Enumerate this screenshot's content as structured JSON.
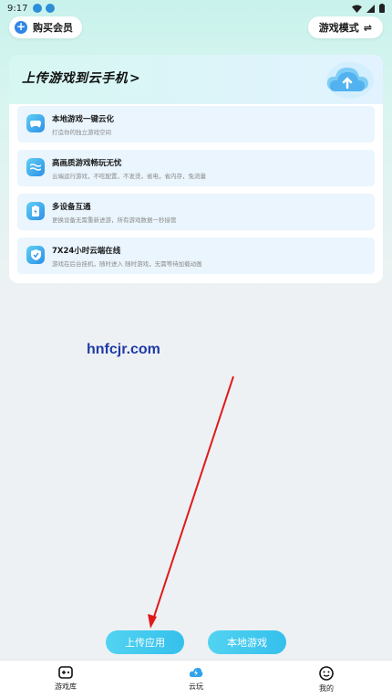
{
  "status_bar": {
    "time": "9:17"
  },
  "header": {
    "buy_member": "购买会员",
    "game_mode": "游戏模式",
    "game_mode_icon": "⇌"
  },
  "card": {
    "title": "上传游戏到云手机",
    "title_chevron": ">",
    "features": [
      {
        "title": "本地游戏一键云化",
        "desc": "打造你的独立游戏空间",
        "icon": "gamepad-icon"
      },
      {
        "title": "高画质游戏畅玩无忧",
        "desc": "云端运行游戏，不吃配置，不发烫，省电，省内存，免流量",
        "icon": "waves-icon"
      },
      {
        "title": "多设备互通",
        "desc": "更换设备无需重新进游，所有游戏数据一秒接管",
        "icon": "battery-icon"
      },
      {
        "title": "7X24小时云端在线",
        "desc": "游戏在后台挂机，随时进入 随时游戏，无需等待加载动画",
        "icon": "shield-check-icon"
      }
    ]
  },
  "watermark": "hnfcjr.com",
  "actions": {
    "upload": "上传应用",
    "local_games": "本地游戏"
  },
  "tabbar": {
    "items": [
      {
        "label": "游戏库",
        "icon": "gamepad-tab-icon"
      },
      {
        "label": "云玩",
        "icon": "lightning-cloud-icon"
      },
      {
        "label": "我的",
        "icon": "smiley-icon"
      }
    ]
  },
  "colors": {
    "accent": "#34c0ec",
    "brand_blue": "#2f86e8",
    "arrow": "#e01a1a",
    "watermark": "#1f3aa8"
  }
}
